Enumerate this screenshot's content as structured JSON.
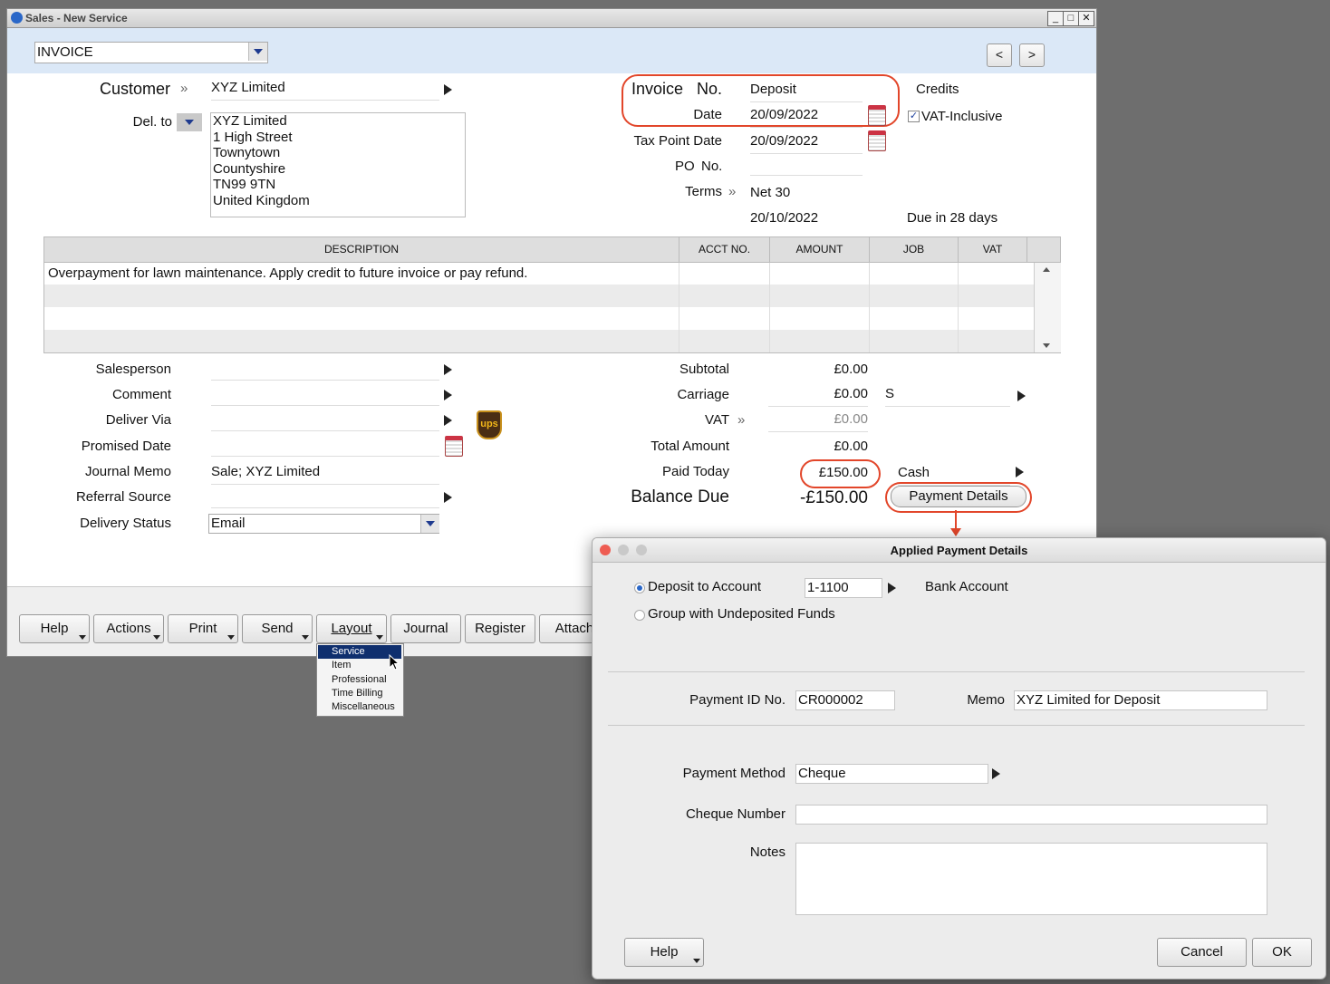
{
  "window": {
    "title": "Sales - New Service"
  },
  "header": {
    "form_type": "INVOICE",
    "prev": "<",
    "next": ">"
  },
  "customer": {
    "label": "Customer",
    "name": "XYZ Limited",
    "del_to_label": "Del. to",
    "address": [
      "XYZ Limited",
      "1 High Street",
      "Townytown",
      "Countyshire",
      "TN99 9TN",
      "United Kingdom"
    ]
  },
  "invoice": {
    "invoice_label": "Invoice",
    "no_label": "No.",
    "invoice_no": "Deposit",
    "date_label": "Date",
    "date": "20/09/2022",
    "tax_point_label": "Tax Point Date",
    "tax_point_date": "20/09/2022",
    "po_label": "PO",
    "po_no_label": "No.",
    "po_no": "",
    "terms_label": "Terms",
    "terms": "Net 30",
    "due_date": "20/10/2022",
    "due_text": "Due in 28 days",
    "credits_label": "Credits",
    "vat_inclusive_label": "VAT-Inclusive",
    "vat_inclusive": true
  },
  "grid": {
    "columns": [
      "DESCRIPTION",
      "ACCT NO.",
      "AMOUNT",
      "JOB",
      "VAT"
    ],
    "rows": [
      {
        "description": "Overpayment for lawn maintenance.  Apply credit to future invoice or pay refund.",
        "acct_no": "",
        "amount": "",
        "job": "",
        "vat": ""
      }
    ]
  },
  "details": {
    "salesperson_label": "Salesperson",
    "salesperson": "",
    "comment_label": "Comment",
    "comment": "",
    "deliver_via_label": "Deliver Via",
    "deliver_via": "",
    "promised_date_label": "Promised Date",
    "promised_date": "",
    "journal_memo_label": "Journal Memo",
    "journal_memo": "Sale; XYZ Limited",
    "referral_source_label": "Referral Source",
    "referral_source": "",
    "delivery_status_label": "Delivery Status",
    "delivery_status": "Email",
    "ups_badge": "ups"
  },
  "totals": {
    "subtotal_label": "Subtotal",
    "subtotal": "£0.00",
    "carriage_label": "Carriage",
    "carriage": "£0.00",
    "carriage_tax": "S",
    "vat_label": "VAT",
    "vat": "£0.00",
    "total_label": "Total Amount",
    "total": "£0.00",
    "paid_today_label": "Paid Today",
    "paid_today": "£150.00",
    "payment_method_short": "Cash",
    "balance_due_label": "Balance Due",
    "balance_due": "-£150.00",
    "payment_details_button": "Payment Details"
  },
  "toolbar": {
    "help": "Help",
    "actions": "Actions",
    "print": "Print",
    "send": "Send",
    "layout": "Layout",
    "journal": "Journal",
    "register": "Register",
    "attach": "Attach"
  },
  "layout_menu": {
    "items": [
      "Service",
      "Item",
      "Professional",
      "Time Billing",
      "Miscellaneous"
    ],
    "selected": "Service"
  },
  "dialog": {
    "title": "Applied Payment Details",
    "deposit_to_account_label": "Deposit to Account",
    "deposit_account": "1-1100",
    "account_name": "Bank Account",
    "group_label": "Group with Undeposited Funds",
    "payment_id_label": "Payment ID No.",
    "payment_id": "CR000002",
    "memo_label": "Memo",
    "memo": "XYZ Limited for Deposit",
    "payment_method_label": "Payment Method",
    "payment_method": "Cheque",
    "cheque_number_label": "Cheque Number",
    "cheque_number": "",
    "notes_label": "Notes",
    "notes": "",
    "help": "Help",
    "cancel": "Cancel",
    "ok": "OK"
  },
  "colors": {
    "highlight": "#e2462a",
    "header_band": "#dbe8f7",
    "menu_selected": "#0f2f6e"
  }
}
